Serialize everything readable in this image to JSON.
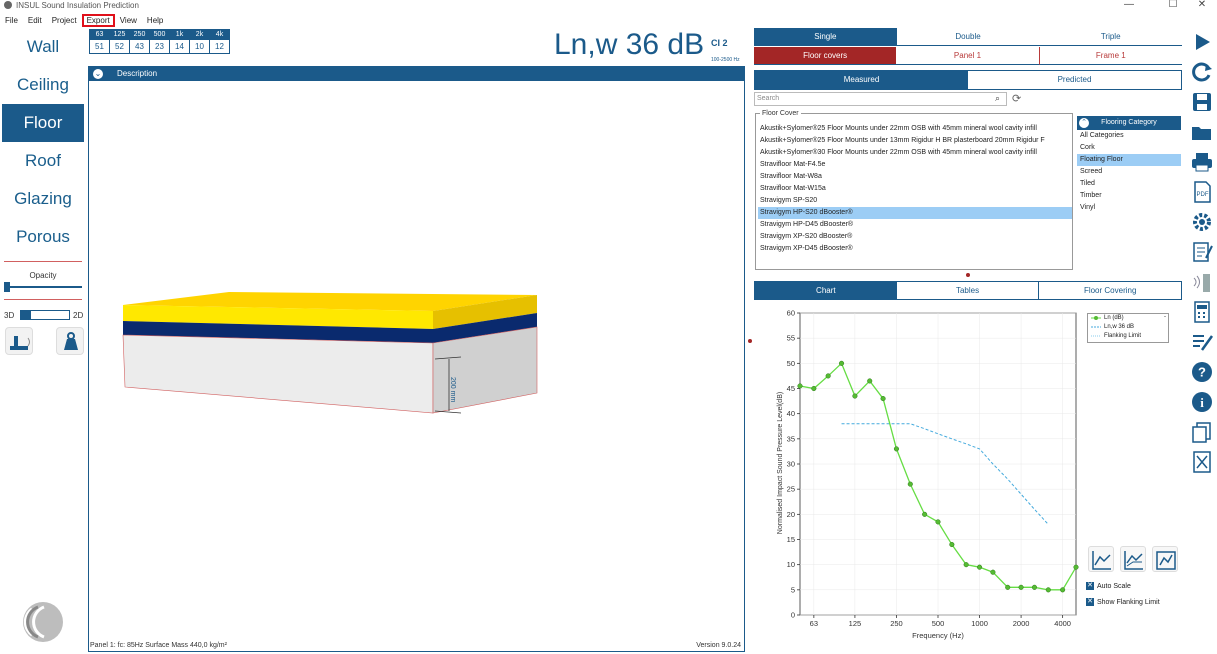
{
  "window": {
    "title": "INSUL Sound Insulation Prediction",
    "minimize": "—",
    "maximize": "☐",
    "close": "✕"
  },
  "menu": [
    {
      "label": "File"
    },
    {
      "label": "Edit"
    },
    {
      "label": "Project"
    },
    {
      "label": "Export",
      "highlighted": true
    },
    {
      "label": "View"
    },
    {
      "label": "Help"
    }
  ],
  "sidebar": {
    "items": [
      {
        "label": "Wall",
        "active": false
      },
      {
        "label": "Ceiling",
        "active": false
      },
      {
        "label": "Floor",
        "active": true
      },
      {
        "label": "Roof",
        "active": false
      },
      {
        "label": "Glazing",
        "active": false
      },
      {
        "label": "Porous",
        "active": false
      }
    ],
    "opacity_label": "Opacity",
    "opacity_value": 0.05,
    "label_3d": "3D",
    "label_2d": "2D",
    "toggle_value": 0.2
  },
  "freq_table": {
    "headers": [
      "63",
      "125",
      "250",
      "500",
      "1k",
      "2k",
      "4k"
    ],
    "values": [
      "51",
      "52",
      "43",
      "23",
      "14",
      "10",
      "12"
    ]
  },
  "rating": {
    "value": "Ln,w 36 dB",
    "ci_label": "CI 2",
    "range": "100-2500 Hz"
  },
  "viewport": {
    "description_label": "Description",
    "chevron": "⌄",
    "dimension_label": "200 mm",
    "status_left": "Panel 1:  fc: 85Hz Surface Mass 440,0 kg/m²",
    "version": "Version 9.0.24"
  },
  "colors": {
    "accent": "#1b5a8a",
    "highlight_red": "#a32626",
    "selected": "#9ccdf5",
    "top_layer": "#ffd400",
    "mid_layer": "#0a2a6e",
    "series_green": "#66dd44",
    "flanking_blue": "#44aadd"
  },
  "layer_tabs": [
    {
      "label": "Single",
      "active": true
    },
    {
      "label": "Double",
      "active": false
    },
    {
      "label": "Triple",
      "active": false
    }
  ],
  "sub_tabs": [
    {
      "label": "Floor covers",
      "active": true
    },
    {
      "label": "Panel 1",
      "active": false
    },
    {
      "label": "Frame 1",
      "active": false
    }
  ],
  "mode_tabs": [
    {
      "label": "Measured",
      "active": true
    },
    {
      "label": "Predicted",
      "active": false
    }
  ],
  "search": {
    "placeholder": "Search"
  },
  "floor_cover": {
    "legend": "Floor Cover",
    "items": [
      {
        "label": "Akustik+Sylomer®25 Floor Mounts under 22mm OSB with 45mm mineral wool cavity infill",
        "selected": false
      },
      {
        "label": "Akustik+Sylomer®25 Floor Mounts under 13mm Rigidur H BR plasterboard  20mm Rigidur F",
        "selected": false
      },
      {
        "label": "Akustik+Sylomer®30 Floor Mounts under 22mm OSB with 45mm mineral wool cavity infill",
        "selected": false
      },
      {
        "label": "Stravifloor Mat-F4.5e",
        "selected": false
      },
      {
        "label": "Stravifloor Mat-W8a",
        "selected": false
      },
      {
        "label": "Stravifloor Mat-W15a",
        "selected": false
      },
      {
        "label": "Stravigym SP-S20",
        "selected": false
      },
      {
        "label": "Stravigym HP-S20  dBooster®",
        "selected": true
      },
      {
        "label": "Stravigym HP-D45  dBooster®",
        "selected": false
      },
      {
        "label": "Stravigym XP-S20  dBooster®",
        "selected": false
      },
      {
        "label": "Stravigym XP-D45  dBooster®",
        "selected": false
      }
    ]
  },
  "category": {
    "header": "Flooring Category",
    "items": [
      {
        "label": "All Categories",
        "selected": false
      },
      {
        "label": "Cork",
        "selected": false
      },
      {
        "label": "Floating Floor",
        "selected": true
      },
      {
        "label": "Screed",
        "selected": false
      },
      {
        "label": "Tiled",
        "selected": false
      },
      {
        "label": "Timber",
        "selected": false
      },
      {
        "label": "Vinyl",
        "selected": false
      }
    ]
  },
  "chart_tabs": [
    {
      "label": "Chart",
      "active": true
    },
    {
      "label": "Tables",
      "active": false
    },
    {
      "label": "Floor Covering",
      "active": false
    }
  ],
  "chart_options": {
    "auto_scale": "Auto Scale",
    "show_flanking": "Show Flanking Limit",
    "check_mark": "✕"
  },
  "chart_data": {
    "type": "line",
    "xlabel": "Frequency (Hz)",
    "ylabel": "Normalised Impact Sound Pressure Level(dB)",
    "ylim": [
      0,
      60
    ],
    "x_scale": "log",
    "x_ticks": [
      "63",
      "125",
      "250",
      "500",
      "1000",
      "2000",
      "4000"
    ],
    "y_ticks": [
      "0",
      "5",
      "10",
      "15",
      "20",
      "25",
      "30",
      "35",
      "40",
      "45",
      "50",
      "55",
      "60"
    ],
    "legend_position": "top-right",
    "series": [
      {
        "name": "Ln (dB)",
        "style": "line-markers",
        "x": [
          50,
          63,
          80,
          100,
          125,
          160,
          200,
          250,
          315,
          400,
          500,
          630,
          800,
          1000,
          1250,
          1600,
          2000,
          2500,
          3150,
          4000,
          5000
        ],
        "y": [
          45.5,
          45,
          47.5,
          50,
          43.5,
          46.5,
          43,
          33,
          26,
          20,
          18.5,
          14,
          10,
          9.5,
          8.5,
          5.5,
          5.5,
          5.5,
          5,
          5,
          9.5
        ]
      },
      {
        "name": "Ln,w 36 dB",
        "style": "dashed",
        "x": [
          100,
          125,
          160,
          200,
          250,
          315,
          400,
          500,
          630,
          800,
          1000,
          1250,
          1600,
          2000,
          2500,
          3150
        ],
        "y": [
          38,
          38,
          38,
          38,
          38,
          38,
          37,
          36,
          35,
          34,
          33,
          30,
          27,
          24,
          21,
          18
        ]
      },
      {
        "name": "Flanking Limit",
        "style": "dotted",
        "x": [],
        "y": []
      }
    ]
  }
}
